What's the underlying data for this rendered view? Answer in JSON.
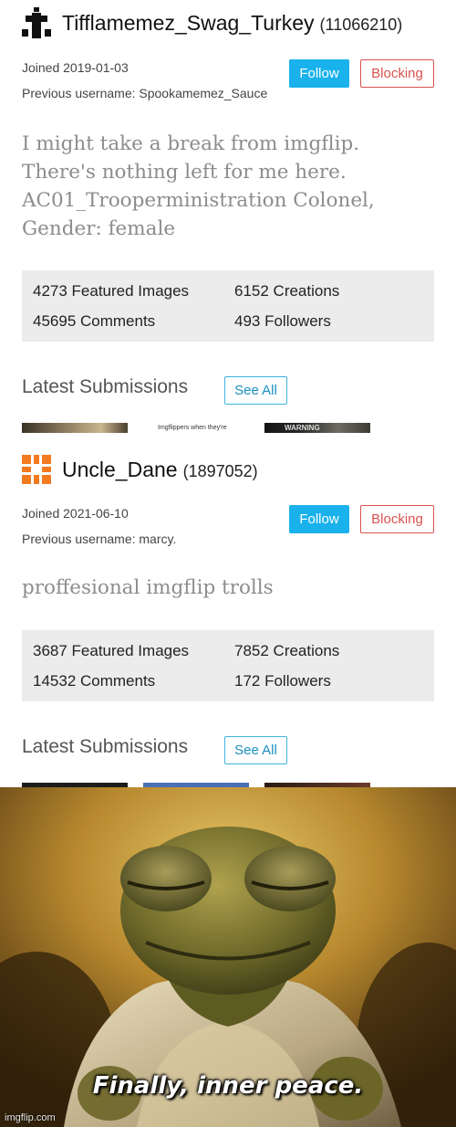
{
  "profiles": [
    {
      "username": "Tifflamemez_Swag_Turkey",
      "user_id": "(11066210)",
      "joined": "Joined 2019-01-03",
      "previous_username": "Previous username: Spookamemez_Sauce",
      "follow_label": "Follow",
      "blocking_label": "Blocking",
      "bio": [
        "I might take a break from imgflip.",
        "There's nothing left for me here.",
        "AC01_Trooperministration Colonel,",
        "Gender: female"
      ],
      "stats": {
        "featured": "4273 Featured Images",
        "creations": "6152 Creations",
        "comments": "45695 Comments",
        "followers": "493 Followers"
      },
      "latest_label": "Latest Submissions",
      "see_all_label": "See All",
      "thumb_text_2": "Imgflippers when they're",
      "thumb_text_3": "WARNING"
    },
    {
      "username": "Uncle_Dane",
      "user_id": "(1897052)",
      "joined": "Joined 2021-06-10",
      "previous_username": "Previous username: marcy.",
      "follow_label": "Follow",
      "blocking_label": "Blocking",
      "bio": [
        "proffesional imgflip trolls"
      ],
      "stats": {
        "featured": "3687 Featured Images",
        "creations": "7852 Creations",
        "comments": "14532 Comments",
        "followers": "172 Followers"
      },
      "latest_label": "Latest Submissions",
      "see_all_label": "See All"
    }
  ],
  "meme": {
    "caption": "Finally, inner peace.",
    "watermark": "imgflip.com"
  },
  "colors": {
    "follow_button": "#1ab2ec",
    "blocking_border": "#d9534f",
    "bio_text": "#8c8c8c",
    "stats_bg": "#ececec",
    "avatar_orange": "#f47a20"
  }
}
